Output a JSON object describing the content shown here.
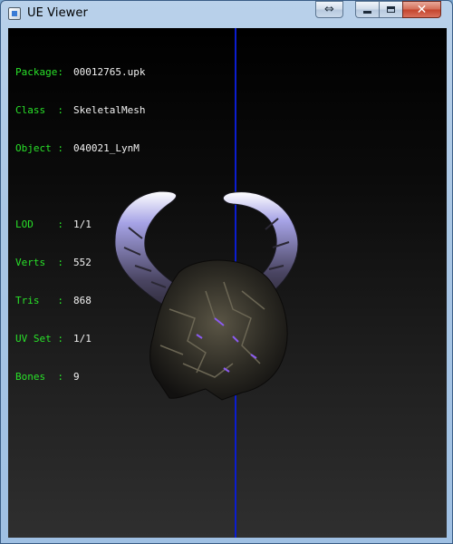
{
  "window": {
    "title": "UE Viewer",
    "fullscreen_icon": "⇔",
    "close_icon": "✕"
  },
  "info": {
    "package": {
      "label": "Package:",
      "value": "00012765.upk"
    },
    "class": {
      "label": "Class  :",
      "value": "SkeletalMesh"
    },
    "object": {
      "label": "Object :",
      "value": "040021_LynM"
    },
    "lod": {
      "label": "LOD    :",
      "value": "1/1"
    },
    "verts": {
      "label": "Verts  :",
      "value": "552"
    },
    "tris": {
      "label": "Tris   :",
      "value": "868"
    },
    "uvset": {
      "label": "UV Set :",
      "value": "1/1"
    },
    "bones": {
      "label": "Bones  :",
      "value": "9"
    }
  },
  "colors": {
    "label_green": "#29e129",
    "value_white": "#f2f2f2",
    "axis_blue": "#0b1dd0"
  }
}
